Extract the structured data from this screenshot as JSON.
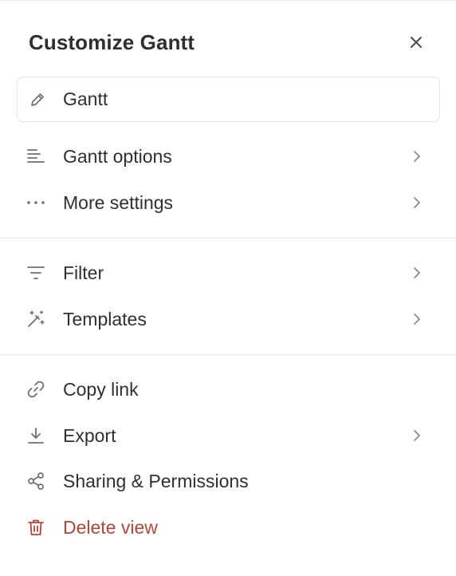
{
  "header": {
    "title": "Customize Gantt",
    "close_icon": "close-icon"
  },
  "view_name": {
    "value": "Gantt",
    "icon": "pencil-icon"
  },
  "sections": [
    {
      "items": [
        {
          "label": "Gantt options",
          "icon": "align-left-icon",
          "has_submenu": true
        },
        {
          "label": "More settings",
          "icon": "ellipsis-icon",
          "has_submenu": true
        }
      ]
    },
    {
      "items": [
        {
          "label": "Filter",
          "icon": "filter-icon",
          "has_submenu": true
        },
        {
          "label": "Templates",
          "icon": "magic-wand-icon",
          "has_submenu": true
        }
      ]
    },
    {
      "items": [
        {
          "label": "Copy link",
          "icon": "link-icon",
          "has_submenu": false
        },
        {
          "label": "Export",
          "icon": "download-icon",
          "has_submenu": true
        },
        {
          "label": "Sharing & Permissions",
          "icon": "share-icon",
          "has_submenu": false
        },
        {
          "label": "Delete view",
          "icon": "trash-icon",
          "has_submenu": false,
          "danger": true
        }
      ]
    }
  ],
  "colors": {
    "text": "#2f2f2f",
    "icon": "#6f6f6f",
    "danger": "#b3463a",
    "divider": "#e6e6e6"
  }
}
